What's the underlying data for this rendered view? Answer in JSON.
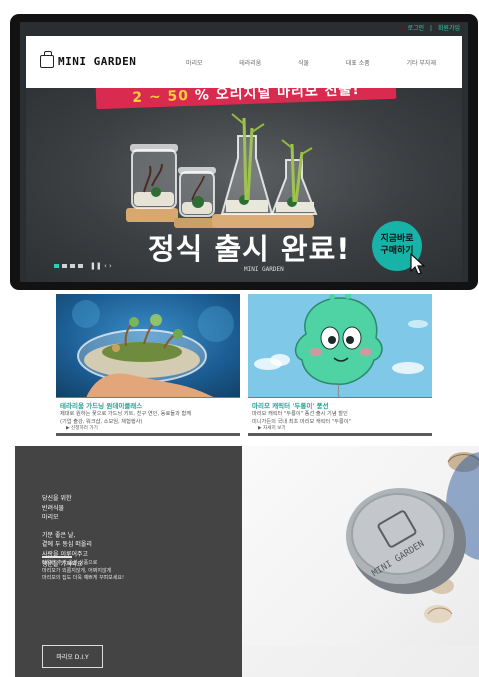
{
  "util": {
    "login": "로그인",
    "separator": "|",
    "join": "회원가입"
  },
  "brand": {
    "name": "MINI GARDEN"
  },
  "menu": [
    "마리모",
    "테라리움",
    "식물",
    "대표 소품",
    "기타 부자재"
  ],
  "hero": {
    "ribbon_text": "% 오리지널 마리모 선물!",
    "headline": "정식 출시 완료!",
    "brand_small": "MINI GARDEN",
    "cta": [
      "지금바로",
      "구매하기"
    ],
    "controls": "❚❚ ‹ ›"
  },
  "cards": [
    {
      "title": "테라리움 가드닝 원데이클래스",
      "desc_line1": "제대로 원하는 꽃으로 가드닝 키트, 친구 연인, 동료들과 함께",
      "desc_line2": "(기업 출강, 워크샵, 소모임, 체험행사)",
      "more": "▶ 신청하러 가기"
    },
    {
      "title": "마리모 캐릭터 '두롱이' 풍선",
      "desc_line1": "마리모 캐릭터 \"두롱이\" 풍선 출시 기념 할인",
      "desc_line2": "미니가든의 국내 최초 마리모 캐릭터 \"두롱이\"",
      "more": "▶ 자세히 보기"
    }
  ],
  "bottom": {
    "lines_a": [
      "당신을 위한",
      "반려식물",
      "마리모"
    ],
    "lines_b": [
      "기분 좋은 날,",
      "곁에 두 동심 떠올리",
      "사랑을 이루어주고",
      "행운을 가져와요"
    ],
    "lines_c": [
      "다양한 추가 옵션 상품으로",
      "마리모가 외롭지않게, 어쩌지않게",
      "마리모의 집도 더욱 예쁘게 꾸며보세요!"
    ],
    "button": "마리오 D.I.Y",
    "jar_label": "MINI GARDEN"
  },
  "colors": {
    "accent": "#2ecdb5",
    "ribbon": "#d92a4f",
    "cta": "#17b3a8",
    "card_title": "#1aa697",
    "dark_panel": "#444445"
  }
}
